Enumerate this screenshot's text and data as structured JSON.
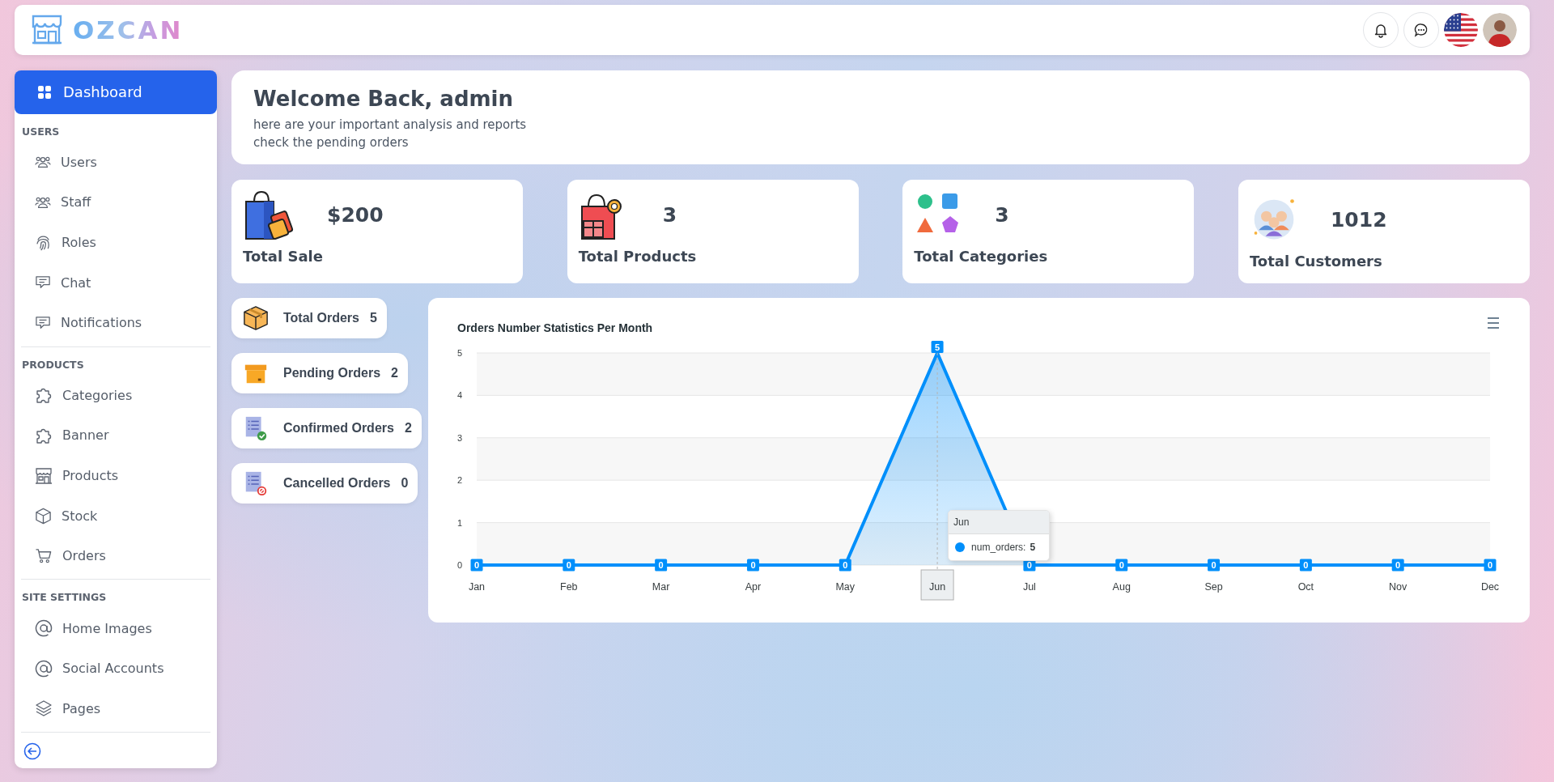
{
  "header": {
    "logo": "OZCAN"
  },
  "sidebar": {
    "dashboard": {
      "label": "Dashboard",
      "selected": true
    },
    "groups": [
      {
        "title": "USERS",
        "items": [
          {
            "label": "Users",
            "selected": false
          },
          {
            "label": "Staff",
            "selected": false
          },
          {
            "label": "Roles",
            "selected": false
          },
          {
            "label": "Chat",
            "selected": false
          },
          {
            "label": "Notifications",
            "selected": false
          }
        ]
      },
      {
        "title": "PRODUCTS",
        "items": [
          {
            "label": "Categories",
            "selected": false
          },
          {
            "label": "Banner",
            "selected": false
          },
          {
            "label": "Products",
            "selected": false
          },
          {
            "label": "Stock",
            "selected": false
          },
          {
            "label": "Orders",
            "selected": false
          }
        ]
      },
      {
        "title": "SITE SETTINGS",
        "items": [
          {
            "label": "Home Images",
            "selected": false
          },
          {
            "label": "Social Accounts",
            "selected": false
          },
          {
            "label": "Pages",
            "selected": false
          }
        ]
      }
    ]
  },
  "welcome": {
    "title": "Welcome Back, admin",
    "lines": [
      "here are your important analysis and reports",
      "check the pending orders"
    ]
  },
  "stats": [
    {
      "label": "Total Sale",
      "value": "$200"
    },
    {
      "label": "Total Products",
      "value": "3"
    },
    {
      "label": "Total Categories",
      "value": "3"
    },
    {
      "label": "Total Customers",
      "value": "1012"
    }
  ],
  "orders": [
    {
      "label": "Total Orders",
      "value": "5"
    },
    {
      "label": "Pending Orders",
      "value": "2"
    },
    {
      "label": "Confirmed Orders",
      "value": "2"
    },
    {
      "label": "Cancelled Orders",
      "value": "0"
    }
  ],
  "chart": {
    "chart_data": {
      "type": "area",
      "title": "Orders Number Statistics Per Month",
      "categories": [
        "Jan",
        "Feb",
        "Mar",
        "Apr",
        "May",
        "Jun",
        "Jul",
        "Aug",
        "Sep",
        "Oct",
        "Nov",
        "Dec"
      ],
      "series": [
        {
          "name": "num_orders",
          "color": "#008ffb",
          "values": [
            0,
            0,
            0,
            0,
            0,
            5,
            0,
            0,
            0,
            0,
            0,
            0
          ]
        }
      ],
      "ylim": [
        0,
        5
      ],
      "yticks": [
        0,
        1,
        2,
        3,
        4,
        5
      ],
      "grid": true,
      "data_labels": true,
      "ref_lines": [
        {
          "axis": "x",
          "value": "Jun"
        }
      ]
    },
    "tooltip": {
      "title": "Jun",
      "separator": ":",
      "value": "5"
    }
  }
}
